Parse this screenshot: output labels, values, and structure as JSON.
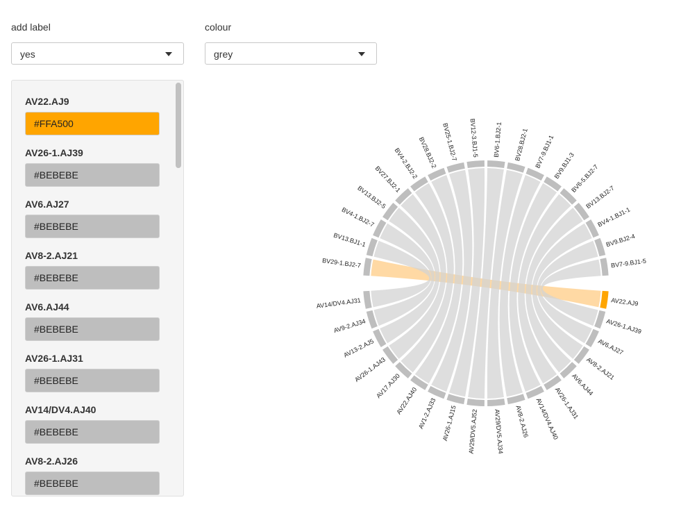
{
  "controls": {
    "add_label": {
      "label": "add label",
      "value": "yes"
    },
    "colour": {
      "label": "colour",
      "value": "grey"
    }
  },
  "colors": {
    "highlight": "#FFA500",
    "default": "#BEBEBE",
    "chord_grey": "#D3D3D3",
    "chord_highlight": "#FFD59A"
  },
  "color_list": [
    {
      "name": "AV22.AJ9",
      "color": "#FFA500"
    },
    {
      "name": "AV26-1.AJ39",
      "color": "#BEBEBE"
    },
    {
      "name": "AV6.AJ27",
      "color": "#BEBEBE"
    },
    {
      "name": "AV8-2.AJ21",
      "color": "#BEBEBE"
    },
    {
      "name": "AV6.AJ44",
      "color": "#BEBEBE"
    },
    {
      "name": "AV26-1.AJ31",
      "color": "#BEBEBE"
    },
    {
      "name": "AV14/DV4.AJ40",
      "color": "#BEBEBE"
    },
    {
      "name": "AV8-2.AJ26",
      "color": "#BEBEBE"
    }
  ],
  "chart_data": {
    "type": "chord",
    "highlight_sector": "AV22.AJ9",
    "highlight_partner": "BV29-1.BJ2-7",
    "sectors": [
      "BV7-9.BJ1-5",
      "BV9.BJ2-4",
      "BV4-1.BJ1-1",
      "BV13.BJ2-7",
      "BV6-5.BJ2-7",
      "BV9.BJ1-3",
      "BV7-9.BJ1-1",
      "BV28.BJ2-1",
      "BV6-1.BJ2-1",
      "BV12-3.BJ1-5",
      "BV25-1.BJ2-7",
      "BV28.BJ2-2",
      "BV4-2.BJ2-2",
      "BV27.BJ2-1",
      "BV13.BJ2-5",
      "BV4-1.BJ2-7",
      "BV13.BJ1-1",
      "BV29-1.BJ2-7",
      "AV14/DV4.AJ31",
      "AV9-2.AJ34",
      "AV13-2.AJ5",
      "AV26-1.AJ43",
      "AV17.AJ30",
      "AV22.AJ40",
      "AV1-2.AJ33",
      "AV26-1.AJ15",
      "AV29/DV5.AJ52",
      "AV29/DV5.AJ34",
      "AV8-2.AJ26",
      "AV14/DV4.AJ40",
      "AV26-1.AJ31",
      "AV6.AJ44",
      "AV8-2.AJ21",
      "AV6.AJ27",
      "AV26-1.AJ39",
      "AV22.AJ9"
    ],
    "links": [
      [
        "AV22.AJ9",
        "BV29-1.BJ2-7"
      ],
      [
        "AV26-1.AJ39",
        "BV7-9.BJ1-5"
      ],
      [
        "AV6.AJ27",
        "BV9.BJ2-4"
      ],
      [
        "AV8-2.AJ21",
        "BV4-1.BJ1-1"
      ],
      [
        "AV6.AJ44",
        "BV13.BJ2-7"
      ],
      [
        "AV26-1.AJ31",
        "BV6-5.BJ2-7"
      ],
      [
        "AV14/DV4.AJ40",
        "BV9.BJ1-3"
      ],
      [
        "AV8-2.AJ26",
        "BV7-9.BJ1-1"
      ],
      [
        "AV29/DV5.AJ34",
        "BV28.BJ2-1"
      ],
      [
        "AV29/DV5.AJ52",
        "BV6-1.BJ2-1"
      ],
      [
        "AV26-1.AJ15",
        "BV12-3.BJ1-5"
      ],
      [
        "AV1-2.AJ33",
        "BV25-1.BJ2-7"
      ],
      [
        "AV22.AJ40",
        "BV28.BJ2-2"
      ],
      [
        "AV17.AJ30",
        "BV4-2.BJ2-2"
      ],
      [
        "AV26-1.AJ43",
        "BV27.BJ2-1"
      ],
      [
        "AV13-2.AJ5",
        "BV13.BJ2-5"
      ],
      [
        "AV9-2.AJ34",
        "BV4-1.BJ2-7"
      ],
      [
        "AV14/DV4.AJ31",
        "BV13.BJ1-1"
      ]
    ]
  }
}
